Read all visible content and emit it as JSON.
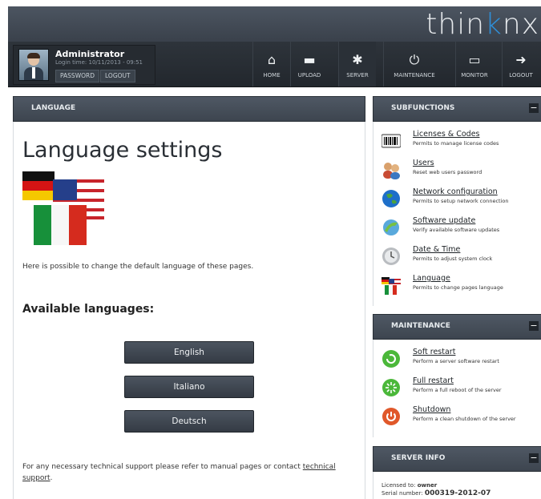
{
  "brand": {
    "prefix": "thin",
    "accent": "k",
    "suffix": "nx"
  },
  "user": {
    "name": "Administrator",
    "login_time": "Login time: 10/11/2013 - 09:51",
    "password_label": "PASSWORD",
    "logout_label": "LOGOUT"
  },
  "nav": [
    {
      "label": "HOME",
      "icon": "home-icon",
      "glyph": "⌂"
    },
    {
      "label": "UPLOAD",
      "icon": "folder-icon",
      "glyph": "▬"
    },
    {
      "label": "SERVER",
      "icon": "gear-icon",
      "glyph": "✱"
    },
    {
      "label": "MAINTENANCE",
      "icon": "power-icon",
      "glyph": "⏻"
    },
    {
      "label": "MONITOR",
      "icon": "monitor-icon",
      "glyph": "▭"
    },
    {
      "label": "LOGOUT",
      "icon": "logout-icon",
      "glyph": "➜"
    }
  ],
  "main": {
    "panel_title": "LANGUAGE",
    "heading": "Language settings",
    "description": "Here is possible to change the default language of these pages.",
    "available_heading": "Available languages:",
    "languages": [
      "English",
      "Italiano",
      "Deutsch"
    ],
    "support_text": "For any necessary technical support please refer to manual pages or contact ",
    "support_link_1": "technical",
    "support_link_2": "support",
    "support_end": "."
  },
  "subfunctions": {
    "title": "SUBFUNCTIONS",
    "items": [
      {
        "title": "Licenses & Codes",
        "desc": "Permits to manage license codes",
        "icon": "barcode-icon"
      },
      {
        "title": "Users",
        "desc": "Reset web users password",
        "icon": "users-icon"
      },
      {
        "title": "Network configuration",
        "desc": "Permits to setup network connection",
        "icon": "globe-icon"
      },
      {
        "title": "Software update",
        "desc": "Verify available software updates",
        "icon": "update-icon"
      },
      {
        "title": "Date & Time",
        "desc": "Permits to adjust system clock",
        "icon": "clock-icon"
      },
      {
        "title": "Language",
        "desc": "Permits to change pages language",
        "icon": "flags-icon"
      }
    ]
  },
  "maintenance": {
    "title": "MAINTENANCE",
    "items": [
      {
        "title": "Soft restart",
        "desc": "Perform a server software restart",
        "icon": "soft-restart-icon"
      },
      {
        "title": "Full restart",
        "desc": "Perform a full reboot of the server",
        "icon": "full-restart-icon"
      },
      {
        "title": "Shutdown",
        "desc": "Perform a clean shutdown of the server",
        "icon": "shutdown-icon"
      }
    ]
  },
  "server_info": {
    "title": "SERVER INFO",
    "licensed_label": "Licensed to:",
    "licensed_value": "owner",
    "serial_label": "Serial number:",
    "serial_value": "000319-2012-07"
  },
  "colors": {
    "accent": "#2f8fd8",
    "header": "#3d454f",
    "button": "#3f4751"
  }
}
